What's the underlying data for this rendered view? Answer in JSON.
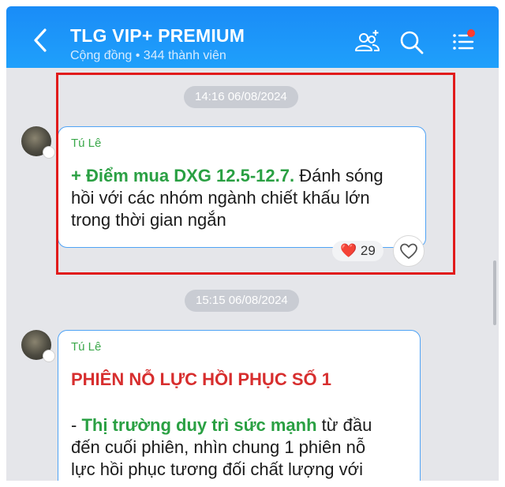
{
  "header": {
    "title": "TLG VIP+ PREMIUM",
    "community": "Cộng đồng",
    "members": "344 thành viên",
    "subtitle_sep": " • "
  },
  "messages": [
    {
      "time": "14:16 06/08/2024",
      "sender": "Tú Lê",
      "text_highlight": "+ Điểm mua DXG 12.5-12.7.",
      "text_line1_rest": " Đánh sóng",
      "text_line2": "hồi với các nhóm ngành chiết khấu lớn",
      "text_line3": "trong thời gian ngắn",
      "reaction_emoji": "❤️",
      "reaction_count": "29"
    },
    {
      "time": "15:15 06/08/2024",
      "sender": "Tú Lê",
      "heading": "PHIÊN NỖ LỰC HỒI PHỤC SỐ 1",
      "bullet_prefix": "- ",
      "text_highlight": "Thị trường duy trì sức mạnh",
      "text_line1_rest": " từ đầu",
      "text_line2": "đến cuối phiên, nhìn chung 1 phiên nỗ",
      "text_line3": "lực hồi phục tương đối chất lượng với"
    }
  ],
  "colors": {
    "header": "#1a8cf7",
    "bubble_border": "#4fa3f5",
    "sender_green": "#3aa84a",
    "highlight_green": "#2aa043",
    "heading_red": "#d72e2e",
    "annotation_red": "#e11b1b",
    "notification_dot": "#ff3b30"
  },
  "icons": {
    "back": "chevron-left-icon",
    "group": "add-member-icon",
    "search": "search-icon",
    "menu": "menu-list-icon"
  }
}
